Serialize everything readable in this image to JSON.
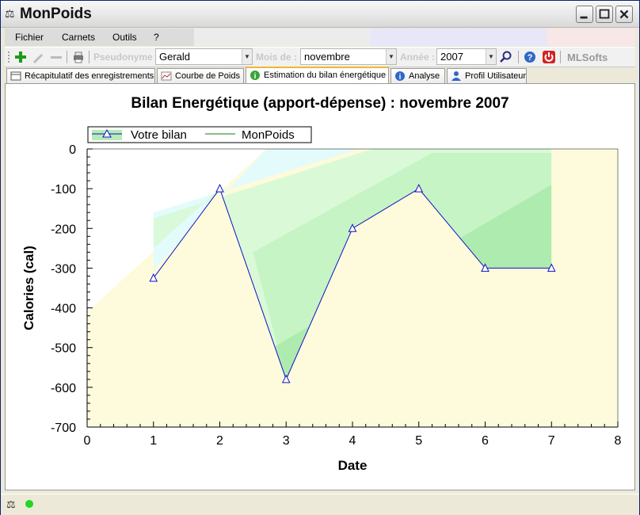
{
  "window": {
    "title": "MonPoids"
  },
  "menu": {
    "items": [
      "Fichier",
      "Carnets",
      "Outils",
      "?"
    ]
  },
  "toolbar": {
    "pseudonyme_label": "Pseudonyme",
    "pseudonyme_value": "Gerald",
    "mois_label": "Mois de :",
    "mois_value": "novembre",
    "annee_label": "Année :",
    "annee_value": "2007",
    "brand": "MLSofts"
  },
  "tabs": [
    {
      "label": "Récapitulatif des enregistrements",
      "icon": "table-icon"
    },
    {
      "label": "Courbe de Poids",
      "icon": "curve-icon"
    },
    {
      "label": "Estimation du bilan énergétique",
      "icon": "energy-icon",
      "active": true
    },
    {
      "label": "Analyse",
      "icon": "info-icon"
    },
    {
      "label": "Profil Utilisateur",
      "icon": "user-icon"
    }
  ],
  "chart_data": {
    "type": "line",
    "title": "Bilan Energétique (apport-dépense) : novembre 2007",
    "xlabel": "Date",
    "ylabel": "Calories (cal)",
    "xlim": [
      0,
      8
    ],
    "ylim": [
      -700,
      0
    ],
    "x_ticks": [
      "0",
      "1",
      "2",
      "3",
      "4",
      "5",
      "6",
      "7",
      "8"
    ],
    "y_ticks": [
      "0",
      "-100",
      "-200",
      "-300",
      "-400",
      "-500",
      "-600",
      "-700"
    ],
    "legend": {
      "placement": "top-left",
      "entries": [
        "Votre bilan",
        "MonPoids"
      ]
    },
    "series": [
      {
        "name": "Votre bilan",
        "x": [
          1,
          2,
          3,
          4,
          5,
          6,
          7
        ],
        "y": [
          -325,
          -100,
          -580,
          -200,
          -100,
          -300,
          -300
        ]
      }
    ],
    "colors": {
      "line": "#1010c8",
      "zone_yellow": "#fdfbdc",
      "zone_cyan": "#e4fbfb",
      "zone_light_green": "#d6fad6",
      "zone_mid_green": "#c2f2c2",
      "zone_dark_green": "#a8e8a8"
    }
  },
  "status": {
    "indicator_color": "#23d623"
  }
}
